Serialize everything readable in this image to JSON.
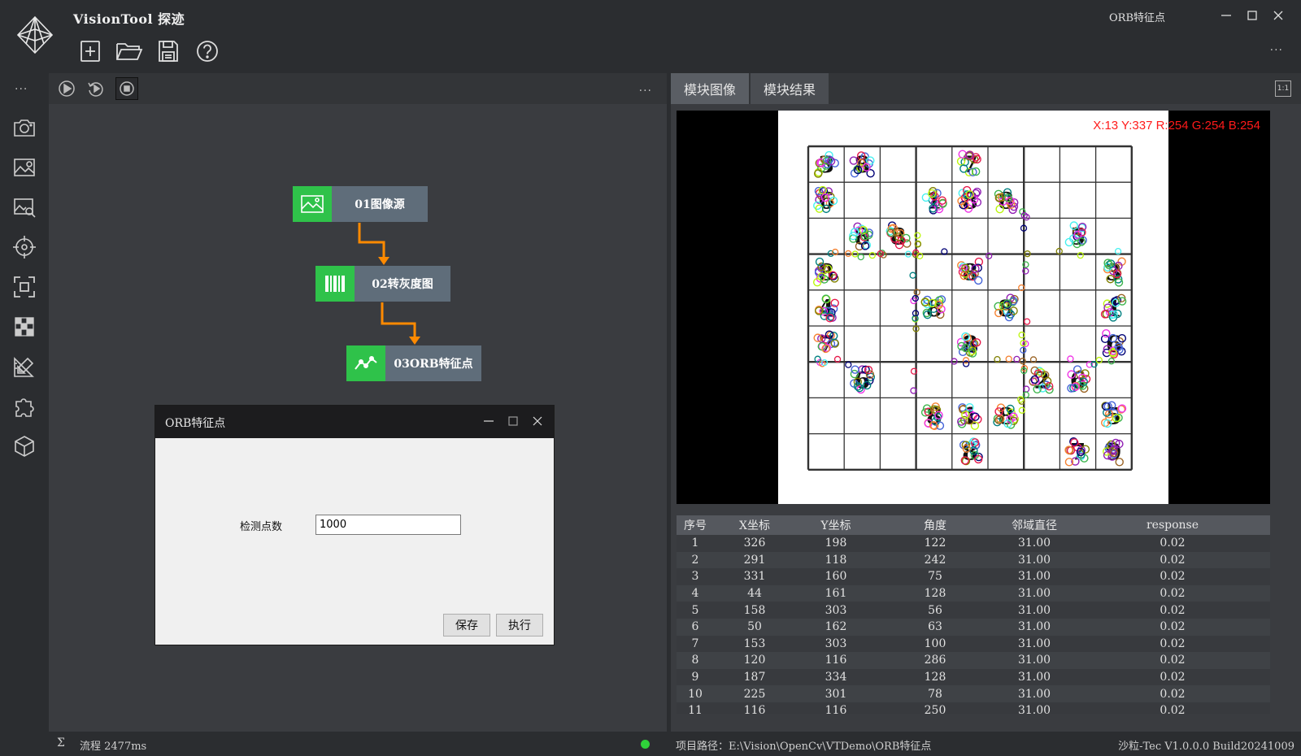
{
  "app": {
    "title": "VisionTool 探迹",
    "module_title": "ORB特征点"
  },
  "icons": {
    "logo": "crystal-logo-icon",
    "toolbar": [
      "new-file-icon",
      "open-folder-icon",
      "save-icon",
      "help-icon"
    ],
    "sidebar": [
      "camera-icon",
      "image-settings-icon",
      "image-search-icon",
      "crosshair-icon",
      "focus-frame-icon",
      "checker-grid-icon",
      "ruler-pencil-icon",
      "puzzle-icon",
      "cube-icon"
    ],
    "flow_toolbar": [
      "run-once-icon",
      "run-loop-icon",
      "stop-icon"
    ]
  },
  "colors": {
    "node_icon_bg": "#2fc24a",
    "node_label_bg": "#5f6d7a",
    "connector": "#ff8a00",
    "status_ok": "#2fd13a",
    "readout": "#ff1a1a"
  },
  "flow": {
    "more_label": "...",
    "nodes": [
      {
        "label": "01图像源",
        "icon": "image-icon"
      },
      {
        "label": "02转灰度图",
        "icon": "barcode-icon"
      },
      {
        "label": "03ORB特征点",
        "icon": "line-chart-icon"
      }
    ]
  },
  "dialog": {
    "title": "ORB特征点",
    "field_label": "检测点数",
    "field_value": "1000",
    "save_label": "保存",
    "run_label": "执行"
  },
  "right": {
    "tabs": [
      "模块图像",
      "模块结果"
    ],
    "fit_label": "1:1",
    "pixel_readout": "X:13 Y:337  R:254 G:254 B:254"
  },
  "sudoku_digits": [
    {
      "row": 0,
      "col": 0,
      "d": "3"
    },
    {
      "row": 0,
      "col": 1,
      "d": "8"
    },
    {
      "row": 0,
      "col": 4,
      "d": "7"
    },
    {
      "row": 1,
      "col": 0,
      "d": "6"
    },
    {
      "row": 1,
      "col": 3,
      "d": "1"
    },
    {
      "row": 1,
      "col": 4,
      "d": "8"
    },
    {
      "row": 1,
      "col": 5,
      "d": "8"
    },
    {
      "row": 2,
      "col": 1,
      "d": "8"
    },
    {
      "row": 2,
      "col": 2,
      "d": "8"
    },
    {
      "row": 2,
      "col": 7,
      "d": "5"
    },
    {
      "row": 3,
      "col": 0,
      "d": "8"
    },
    {
      "row": 3,
      "col": 4,
      "d": "8"
    },
    {
      "row": 3,
      "col": 8,
      "d": "3"
    },
    {
      "row": 4,
      "col": 0,
      "d": "4"
    },
    {
      "row": 4,
      "col": 3,
      "d": "8"
    },
    {
      "row": 4,
      "col": 5,
      "d": "8"
    },
    {
      "row": 4,
      "col": 8,
      "d": "1"
    },
    {
      "row": 5,
      "col": 0,
      "d": "7"
    },
    {
      "row": 5,
      "col": 4,
      "d": "8"
    },
    {
      "row": 5,
      "col": 8,
      "d": "6"
    },
    {
      "row": 6,
      "col": 1,
      "d": "6"
    },
    {
      "row": 6,
      "col": 6,
      "d": "2"
    },
    {
      "row": 6,
      "col": 7,
      "d": "6"
    },
    {
      "row": 7,
      "col": 3,
      "d": "8"
    },
    {
      "row": 7,
      "col": 4,
      "d": "1"
    },
    {
      "row": 7,
      "col": 5,
      "d": "8"
    },
    {
      "row": 7,
      "col": 8,
      "d": "5"
    },
    {
      "row": 8,
      "col": 4,
      "d": "8"
    },
    {
      "row": 8,
      "col": 7,
      "d": "7"
    },
    {
      "row": 8,
      "col": 8,
      "d": "9"
    }
  ],
  "results": {
    "columns": [
      "序号",
      "X坐标",
      "Y坐标",
      "角度",
      "邻域直径",
      "response"
    ],
    "rows": [
      [
        "1",
        "326",
        "198",
        "122",
        "31.00",
        "0.02"
      ],
      [
        "2",
        "291",
        "118",
        "242",
        "31.00",
        "0.02"
      ],
      [
        "3",
        "331",
        "160",
        "75",
        "31.00",
        "0.02"
      ],
      [
        "4",
        "44",
        "161",
        "128",
        "31.00",
        "0.02"
      ],
      [
        "5",
        "158",
        "303",
        "56",
        "31.00",
        "0.02"
      ],
      [
        "6",
        "50",
        "162",
        "63",
        "31.00",
        "0.02"
      ],
      [
        "7",
        "153",
        "303",
        "100",
        "31.00",
        "0.02"
      ],
      [
        "8",
        "120",
        "116",
        "286",
        "31.00",
        "0.02"
      ],
      [
        "9",
        "187",
        "334",
        "128",
        "31.00",
        "0.02"
      ],
      [
        "10",
        "225",
        "301",
        "78",
        "31.00",
        "0.02"
      ],
      [
        "11",
        "116",
        "116",
        "250",
        "31.00",
        "0.02"
      ]
    ]
  },
  "status": {
    "sigma": "Σ",
    "flow_time": "流程  2477ms",
    "path": "项目路径：E:\\Vision\\OpenCv\\VTDemo\\ORB特征点",
    "version": "沙粒-Tec V1.0.0.0 Build20241009"
  }
}
